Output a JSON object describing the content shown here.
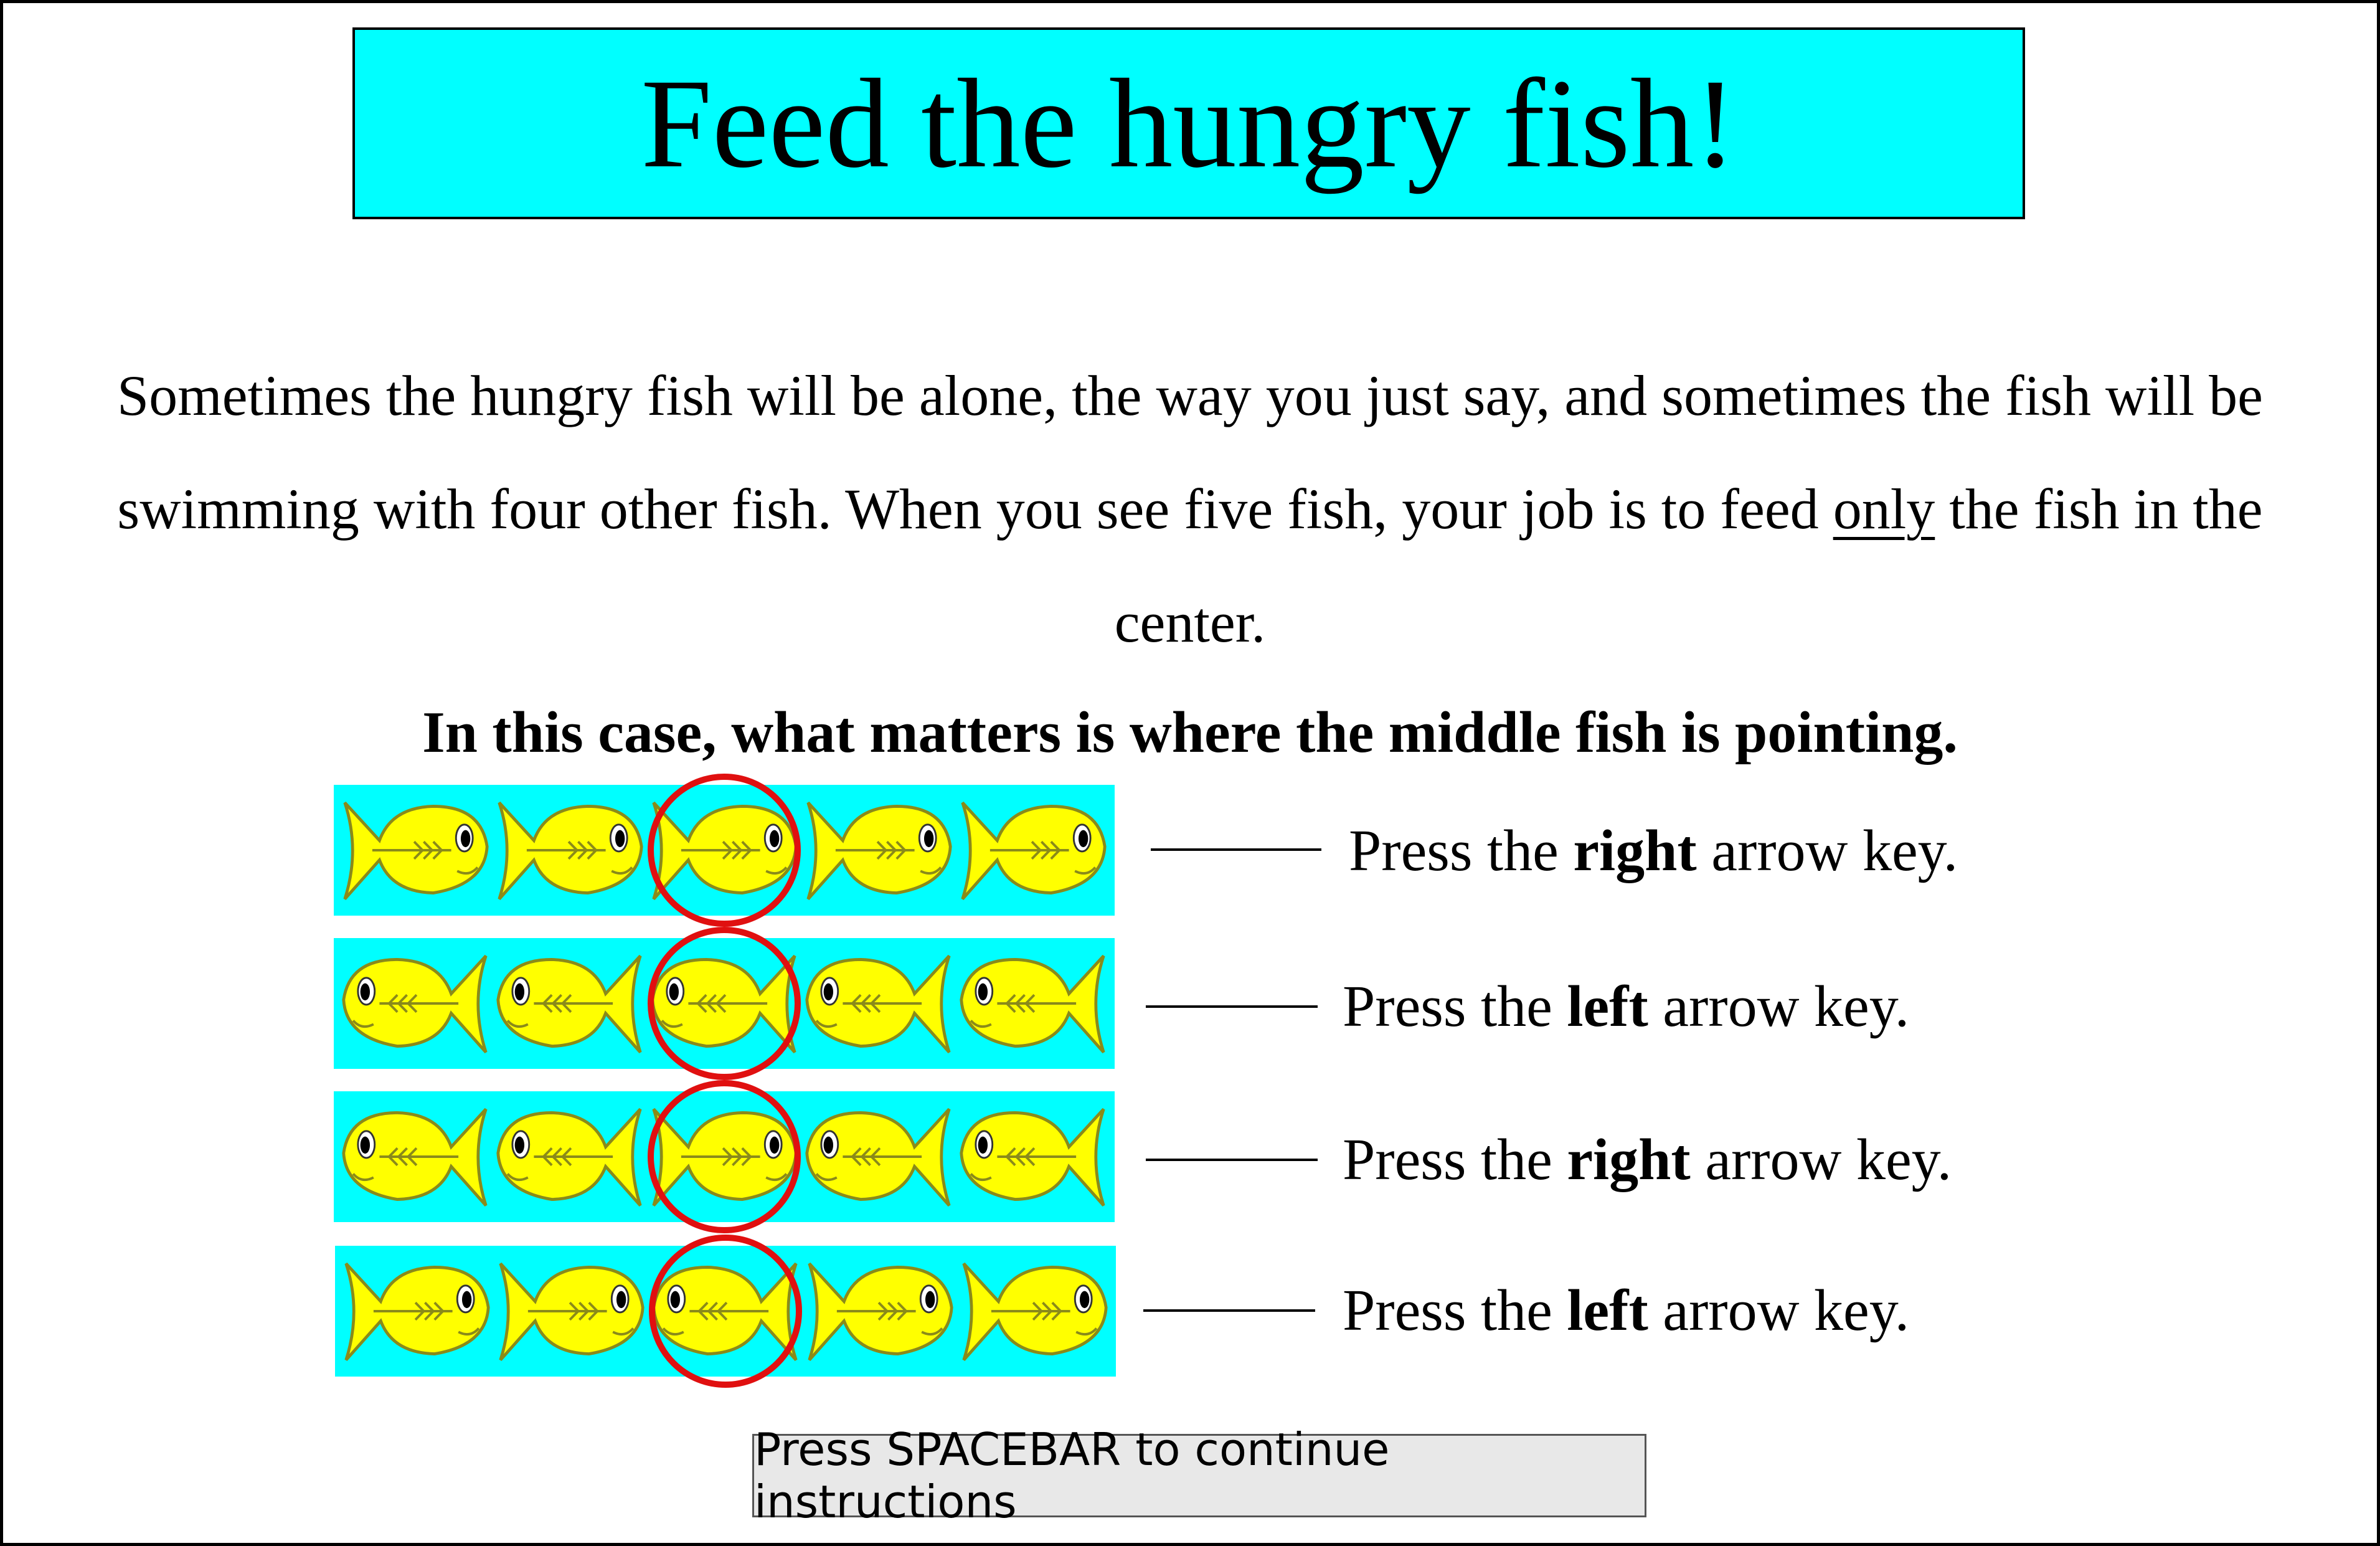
{
  "title": "Feed the hungry fish!",
  "paragraph": {
    "part1": "Sometimes the hungry fish will be alone, the way you just say, and sometimes the fish will be swimming with four other fish. When you see five fish, your job is to feed ",
    "underlined": "only",
    "part2": " the fish in the center."
  },
  "emphasis": "In this case, what matters is where the middle fish is pointing.",
  "rows": [
    {
      "fish_directions": [
        "right",
        "right",
        "right",
        "right",
        "right"
      ],
      "instr_prefix": "Press the ",
      "instr_key": "right",
      "instr_suffix": " arrow key."
    },
    {
      "fish_directions": [
        "left",
        "left",
        "left",
        "left",
        "left"
      ],
      "instr_prefix": "Press the ",
      "instr_key": "left",
      "instr_suffix": " arrow key."
    },
    {
      "fish_directions": [
        "left",
        "left",
        "right",
        "left",
        "left"
      ],
      "instr_prefix": "Press the ",
      "instr_key": "right",
      "instr_suffix": " arrow key."
    },
    {
      "fish_directions": [
        "right",
        "right",
        "left",
        "right",
        "right"
      ],
      "instr_prefix": "Press the ",
      "instr_key": "left",
      "instr_suffix": " arrow key."
    }
  ],
  "colors": {
    "title_bg": "#00ffff",
    "strip_bg": "#00ffff",
    "fish_body": "#ffff00",
    "fish_outline": "#8a8a1a",
    "highlight_circle": "#e01010"
  },
  "icons": {
    "fish": "fish-icon",
    "highlight": "highlight-circle-icon"
  },
  "continue_button": "Press SPACEBAR to continue instructions"
}
